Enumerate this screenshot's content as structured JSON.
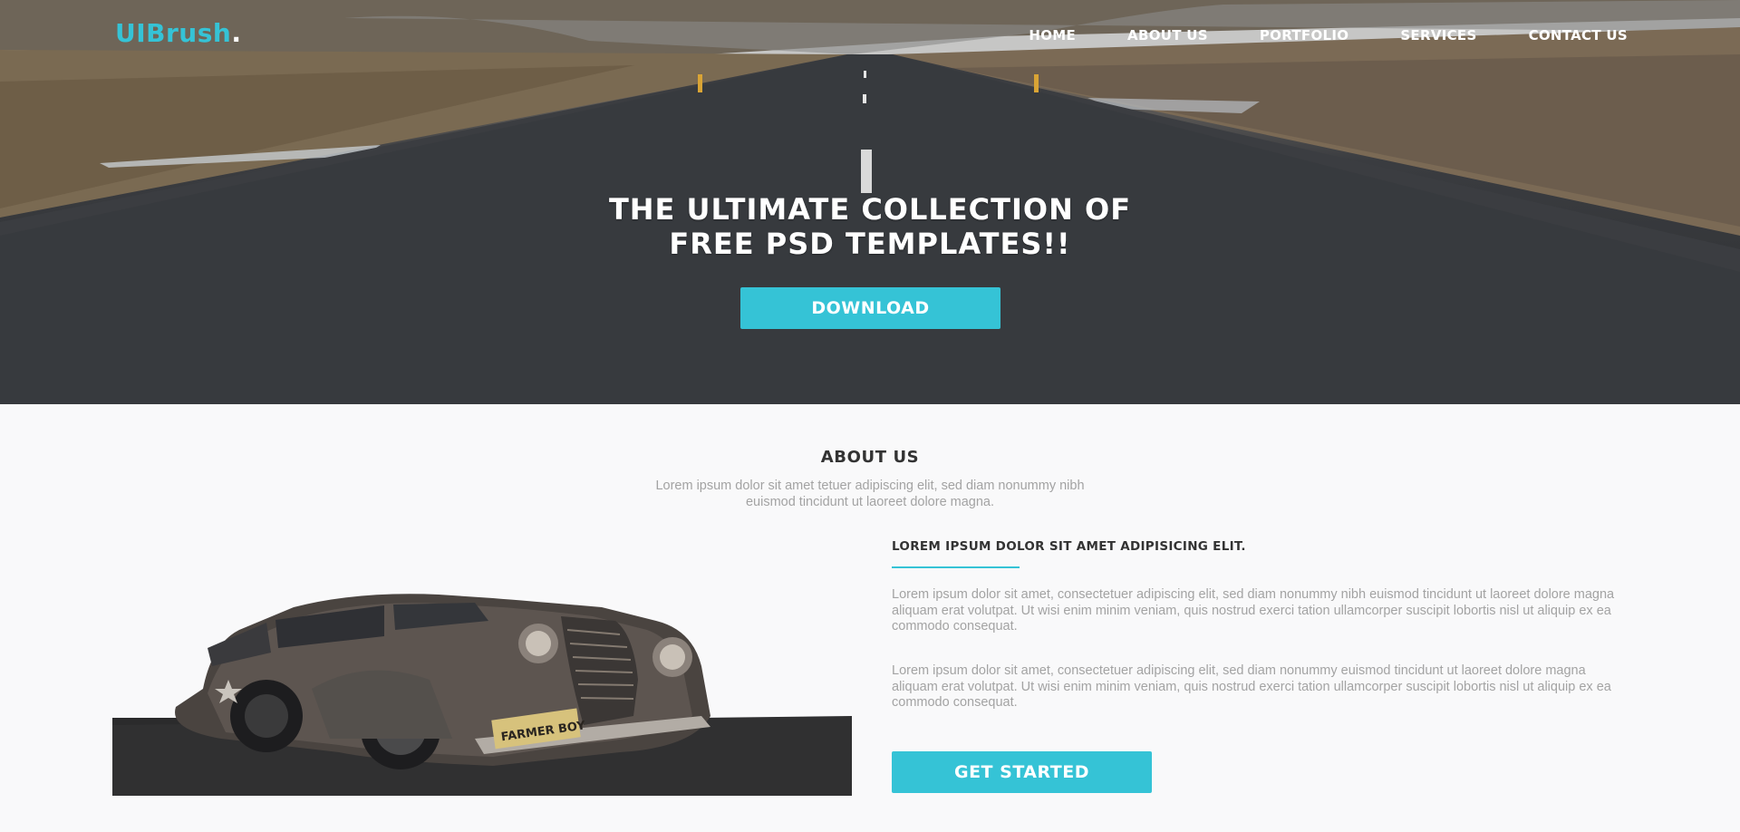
{
  "brand": {
    "name": "UIBrush",
    "dot": ".",
    "accent": "#35c3d6"
  },
  "nav": {
    "items": [
      {
        "label": "HOME"
      },
      {
        "label": "ABOUT US"
      },
      {
        "label": "PORTFOLIO"
      },
      {
        "label": "SERVICES"
      },
      {
        "label": "CONTACT US"
      }
    ]
  },
  "hero": {
    "title_line1": "THE ULTIMATE COLLECTION OF",
    "title_line2": "FREE PSD TEMPLATES!!",
    "button": "DOWNLOAD"
  },
  "about": {
    "title": "ABOUT US",
    "subtitle_line1": "Lorem ipsum dolor sit amet tetuer adipiscing elit, sed diam nonummy nibh",
    "subtitle_line2": "euismod tincidunt ut laoreet dolore magna.",
    "heading": "LOREM IPSUM DOLOR SIT AMET ADIPISICING ELIT.",
    "paragraph1": "Lorem ipsum dolor sit amet, consectetuer adipiscing elit, sed diam nonummy nibh euismod tincidunt ut laoreet dolore magna aliquam erat volutpat. Ut wisi enim minim veniam, quis nostrud exerci tation ullamcorper suscipit lobortis nisl ut aliquip ex ea commodo consequat.",
    "paragraph2": "Lorem ipsum dolor sit amet, consectetuer adipiscing elit, sed diam nonummy euismod tincidunt ut laoreet dolore magna aliquam erat volutpat. Ut wisi enim minim veniam, quis nostrud exerci tation ullamcorper suscipit lobortis nisl ut aliquip ex ea commodo consequat.",
    "button": "GET STARTED",
    "plate_text": "FARMER BOY"
  }
}
